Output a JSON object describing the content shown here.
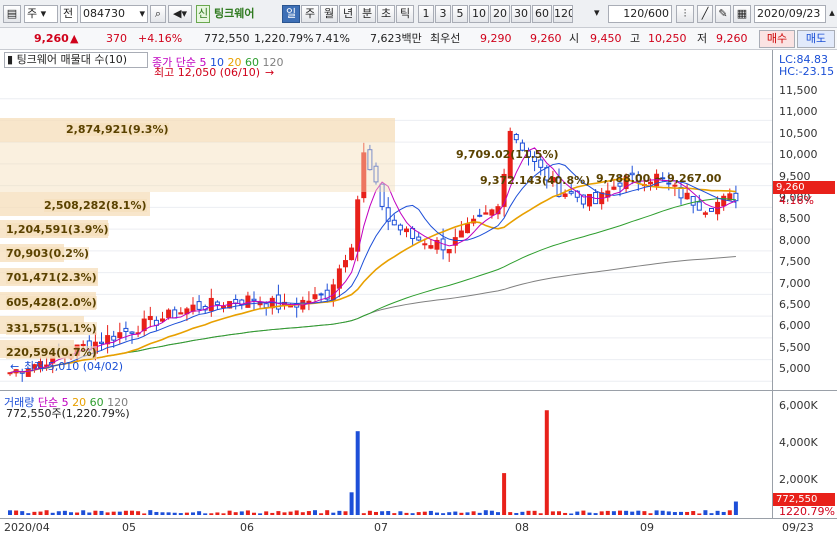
{
  "toolbar": {
    "market": "주",
    "kind": "전",
    "code": "084730",
    "badge": "신",
    "name": "팅크웨어",
    "periods": [
      "일",
      "주",
      "월",
      "년",
      "분",
      "초",
      "틱"
    ],
    "active_period": "일",
    "numbers": [
      "1",
      "3",
      "5",
      "10",
      "20",
      "30",
      "60",
      "120"
    ],
    "count": "120",
    "count_total": "/600",
    "date": "2020/09/23"
  },
  "quote": {
    "price": "9,260",
    "arrow": "▲",
    "change": "370",
    "pct": "+4.16%",
    "volume": "772,550",
    "vol_ratio": "1,220.79%",
    "turnover": "7.41%",
    "amount": "7,623백만",
    "best_ask_label": "최우선",
    "best_ask": "9,290",
    "best_bid": "9,260",
    "open_label": "시",
    "open": "9,450",
    "high_label": "고",
    "high": "10,250",
    "low_label": "저",
    "low": "9,260",
    "buy": "매수",
    "sell": "매도"
  },
  "price_panel": {
    "tab": "팅크웨어 매물대 수(10)",
    "legend": {
      "name": "종가 단순",
      "p5": "5",
      "p10": "10",
      "p20": "20",
      "p60": "60",
      "p120": "120"
    },
    "high_note": "최고 12,050 (06/10)",
    "low_note": "최저 5,010 (04/02)",
    "lc": "LC:84.83",
    "hc": "HC:-23.15",
    "ticks": [
      "11,500",
      "11,000",
      "10,500",
      "10,000",
      "9,500",
      "9,000",
      "8,500",
      "8,000",
      "7,500",
      "7,000",
      "6,500",
      "6,000",
      "5,500",
      "5,000"
    ],
    "current_flag": "9,260",
    "current_pct": "4.16%",
    "bands": [
      "2,874,921(9.3%)",
      "2,508,282(8.1%)",
      "1,204,591(3.9%)",
      "70,903(0.2%)",
      "701,471(2.3%)",
      "605,428(2.0%)",
      "331,575(1.1%)",
      "220,594(0.7%)"
    ],
    "annotations": [
      "9,709.02(11.5%)",
      "9,372.143(40.8%)",
      "9,788.00 ~ 9,267.00"
    ]
  },
  "volume_panel": {
    "legend": {
      "name": "거래량",
      "ma": "단순",
      "p5": "5",
      "p20": "20",
      "p60": "60",
      "p120": "120"
    },
    "sub": "772,550주(1,220.79%)",
    "ticks": [
      "6,000K",
      "4,000K",
      "2,000K"
    ],
    "flag": "772,550",
    "flag_pct": "1220.79%"
  },
  "x_axis": [
    "2020/04",
    "05",
    "06",
    "07",
    "08",
    "09",
    "09/23"
  ],
  "colors": {
    "up": "#e8211a",
    "down": "#1d4fd8",
    "ma5": "#c000c0",
    "ma10": "#1d4fd8",
    "ma20": "#e8a000",
    "ma60": "#2e9e2e",
    "ma120": "#808080"
  }
}
